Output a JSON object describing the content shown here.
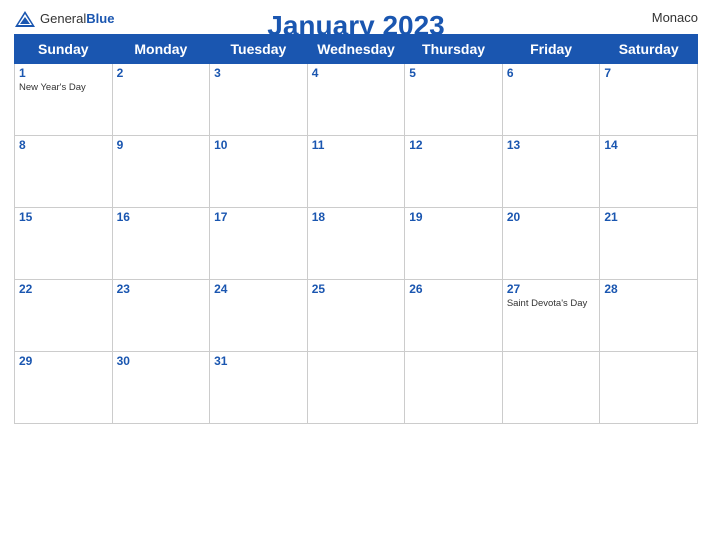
{
  "header": {
    "title": "January 2023",
    "country": "Monaco",
    "logo": {
      "general": "General",
      "blue": "Blue"
    }
  },
  "weekdays": [
    "Sunday",
    "Monday",
    "Tuesday",
    "Wednesday",
    "Thursday",
    "Friday",
    "Saturday"
  ],
  "weeks": [
    [
      {
        "day": "1",
        "holiday": "New Year's Day"
      },
      {
        "day": "2",
        "holiday": ""
      },
      {
        "day": "3",
        "holiday": ""
      },
      {
        "day": "4",
        "holiday": ""
      },
      {
        "day": "5",
        "holiday": ""
      },
      {
        "day": "6",
        "holiday": ""
      },
      {
        "day": "7",
        "holiday": ""
      }
    ],
    [
      {
        "day": "8",
        "holiday": ""
      },
      {
        "day": "9",
        "holiday": ""
      },
      {
        "day": "10",
        "holiday": ""
      },
      {
        "day": "11",
        "holiday": ""
      },
      {
        "day": "12",
        "holiday": ""
      },
      {
        "day": "13",
        "holiday": ""
      },
      {
        "day": "14",
        "holiday": ""
      }
    ],
    [
      {
        "day": "15",
        "holiday": ""
      },
      {
        "day": "16",
        "holiday": ""
      },
      {
        "day": "17",
        "holiday": ""
      },
      {
        "day": "18",
        "holiday": ""
      },
      {
        "day": "19",
        "holiday": ""
      },
      {
        "day": "20",
        "holiday": ""
      },
      {
        "day": "21",
        "holiday": ""
      }
    ],
    [
      {
        "day": "22",
        "holiday": ""
      },
      {
        "day": "23",
        "holiday": ""
      },
      {
        "day": "24",
        "holiday": ""
      },
      {
        "day": "25",
        "holiday": ""
      },
      {
        "day": "26",
        "holiday": ""
      },
      {
        "day": "27",
        "holiday": "Saint Devota's Day"
      },
      {
        "day": "28",
        "holiday": ""
      }
    ],
    [
      {
        "day": "29",
        "holiday": ""
      },
      {
        "day": "30",
        "holiday": ""
      },
      {
        "day": "31",
        "holiday": ""
      },
      {
        "day": "",
        "holiday": ""
      },
      {
        "day": "",
        "holiday": ""
      },
      {
        "day": "",
        "holiday": ""
      },
      {
        "day": "",
        "holiday": ""
      }
    ]
  ]
}
